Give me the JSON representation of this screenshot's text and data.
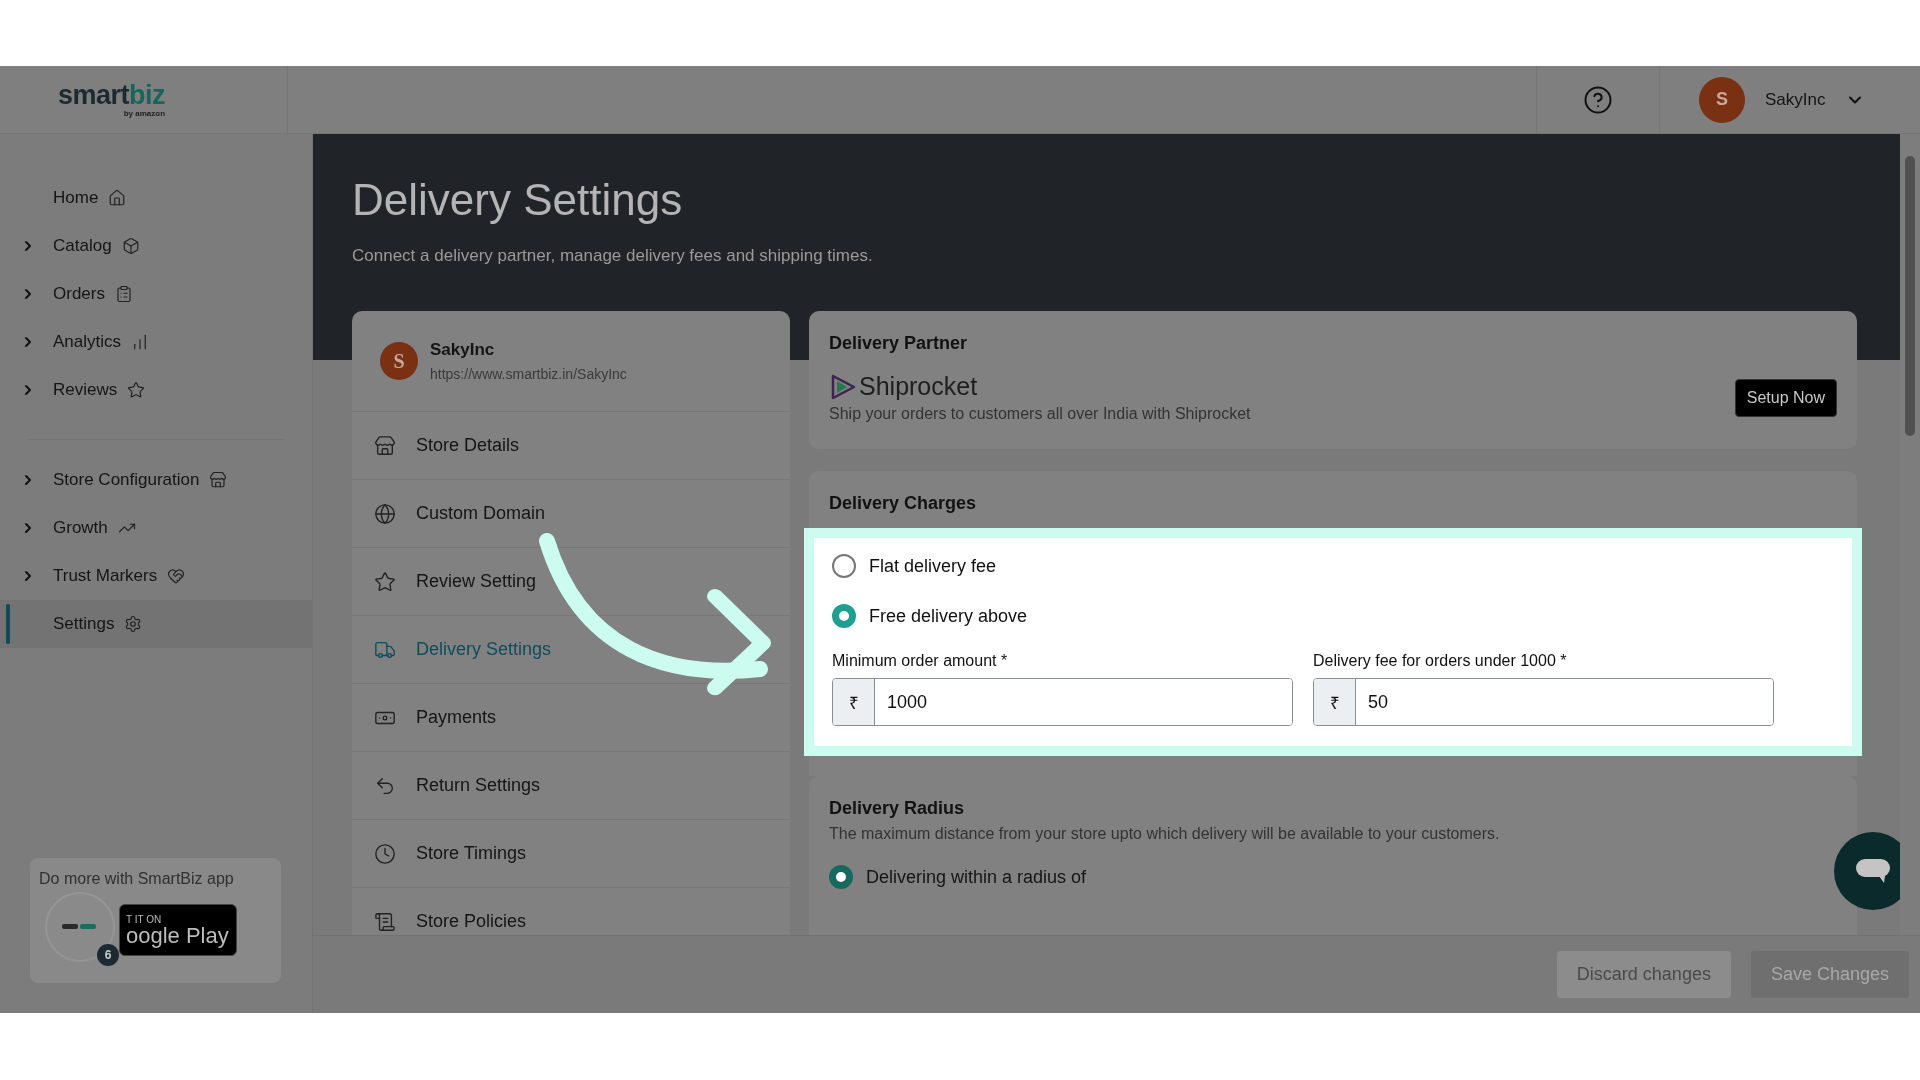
{
  "header": {
    "logo": {
      "primary": "smart",
      "accent": "biz",
      "tagline": "by amazon"
    },
    "user": {
      "initial": "S",
      "name": "SakyInc"
    }
  },
  "sidebar": {
    "groups": [
      [
        {
          "label": "Home",
          "expandable": false,
          "selected": false
        },
        {
          "label": "Catalog",
          "expandable": true,
          "selected": false
        },
        {
          "label": "Orders",
          "expandable": true,
          "selected": false
        },
        {
          "label": "Analytics",
          "expandable": true,
          "selected": false
        },
        {
          "label": "Reviews",
          "expandable": true,
          "selected": false
        }
      ],
      [
        {
          "label": "Store Configuration",
          "expandable": true,
          "selected": false
        },
        {
          "label": "Growth",
          "expandable": true,
          "selected": false
        },
        {
          "label": "Trust Markers",
          "expandable": true,
          "selected": false
        },
        {
          "label": "Settings",
          "expandable": false,
          "selected": true
        }
      ]
    ],
    "promo": {
      "text": "Do more with SmartBiz app",
      "badge_small": "T IT ON",
      "badge_large": "oogle Play",
      "count": "6"
    }
  },
  "page": {
    "title": "Delivery Settings",
    "subtitle": "Connect a delivery partner, manage delivery fees and shipping times."
  },
  "store_card": {
    "initial": "S",
    "name": "SakyInc",
    "url": "https://www.smartbiz.in/SakyInc"
  },
  "settings_menu": [
    {
      "label": "Store Details",
      "selected": false
    },
    {
      "label": "Custom Domain",
      "selected": false
    },
    {
      "label": "Review Setting",
      "selected": false
    },
    {
      "label": "Delivery Settings",
      "selected": true
    },
    {
      "label": "Payments",
      "selected": false
    },
    {
      "label": "Return Settings",
      "selected": false
    },
    {
      "label": "Store Timings",
      "selected": false
    },
    {
      "label": "Store Policies",
      "selected": false
    }
  ],
  "delivery_partner": {
    "title": "Delivery Partner",
    "brand": "Shiprocket",
    "description": "Ship your orders to customers all over India with Shiprocket",
    "button": "Setup Now"
  },
  "delivery_charges": {
    "title": "Delivery Charges",
    "options": [
      {
        "label": "Flat delivery fee",
        "selected": false
      },
      {
        "label": "Free delivery above",
        "selected": true
      }
    ],
    "fields": [
      {
        "label": "Minimum order amount *",
        "prefix": "₹",
        "value": "1000"
      },
      {
        "label": "Delivery fee for orders under 1000 *",
        "prefix": "₹",
        "value": "50"
      }
    ]
  },
  "delivery_radius": {
    "title": "Delivery Radius",
    "description": "The maximum distance from your store upto which delivery will be available to your customers.",
    "options": [
      {
        "label": "Delivering within a radius of",
        "selected": true
      }
    ]
  },
  "footer": {
    "buttons": [
      {
        "label": "Discard changes",
        "kind": "secondary",
        "disabled": true
      },
      {
        "label": "Save Changes",
        "kind": "primary",
        "disabled": true
      }
    ]
  }
}
